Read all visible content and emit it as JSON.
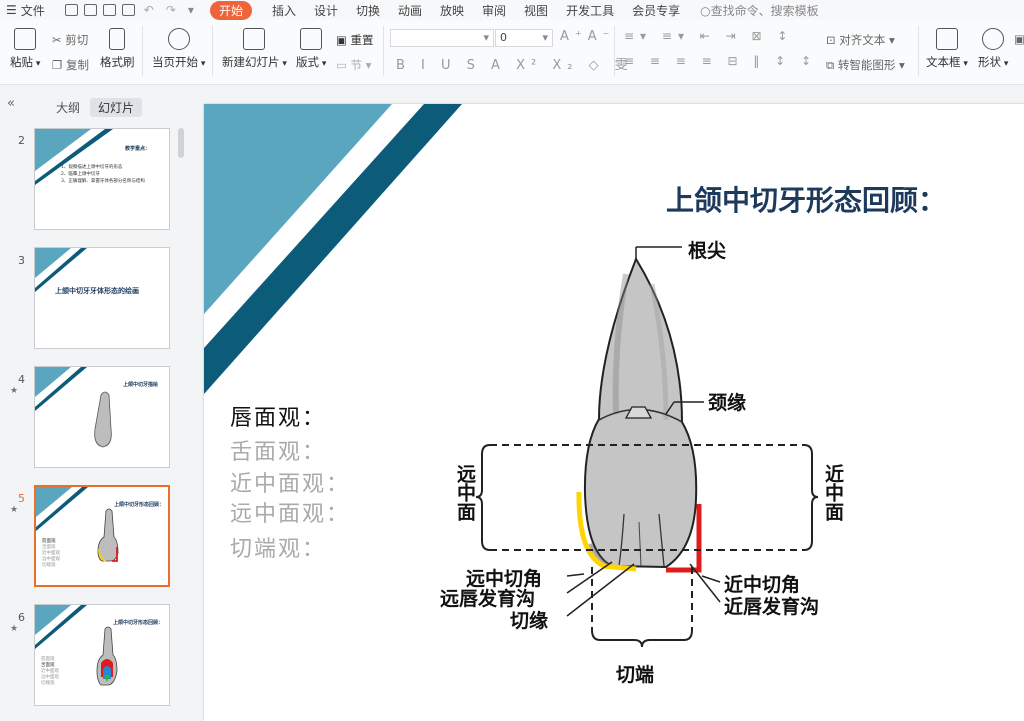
{
  "menubar": {
    "file_label": "文件",
    "tabs": [
      "开始",
      "插入",
      "设计",
      "切换",
      "动画",
      "放映",
      "审阅",
      "视图",
      "开发工具",
      "会员专享"
    ],
    "active_tab": "开始",
    "search_placeholder": "查找命令、搜索模板"
  },
  "ribbon": {
    "paste": "粘贴",
    "cut": "剪切",
    "copy": "复制",
    "format_painter": "格式刷",
    "from_current": "当页开始",
    "new_slide": "新建幻灯片",
    "layout": "版式",
    "reset": "重置",
    "section": "节",
    "font_size": "0",
    "align_text": "对齐文本",
    "smartart": "转智能图形",
    "textbox": "文本框",
    "shapes": "形状"
  },
  "panel": {
    "tab_outline": "大纲",
    "tab_slides": "幻灯片",
    "thumbnails": [
      {
        "num": "2",
        "title": "教学重点：",
        "lines": [
          "1、观察描述上颌中切牙的形态",
          "2、临摹上颌中切牙",
          "3、正确理解、掌握牙体各部分名称与结构"
        ]
      },
      {
        "num": "3",
        "title": "上颌中切牙牙体形态的绘画",
        "lines": []
      },
      {
        "num": "4",
        "title": "上颌中切牙描绘",
        "lines": []
      },
      {
        "num": "5",
        "title": "上颌中切牙形态回顾：",
        "lines": [
          "唇面观",
          "舌面观",
          "近中面观",
          "远中面观",
          "切端观"
        ]
      },
      {
        "num": "6",
        "title": "上颌中切牙形态回顾：",
        "lines": [
          "唇面观",
          "舌面观",
          "近中面观",
          "远中面观",
          "切端观"
        ]
      }
    ],
    "current_num": "5"
  },
  "slide": {
    "title": "上颌中切牙形态回顾：",
    "views": [
      "唇面观：",
      "舌面观：",
      "近中面观：",
      "远中面观：",
      "切端观："
    ],
    "active_view_index": 0,
    "labels": {
      "apex": "根尖",
      "cervical": "颈缘",
      "mesial_side": "近中面",
      "distal_side": "远中面",
      "distal_incisal_angle": "远中切角",
      "distal_labial_groove": "远唇发育沟",
      "incisal_edge": "切缘",
      "mesial_incisal_angle": "近中切角",
      "mesial_labial_groove": "近唇发育沟",
      "incisal_end": "切端"
    },
    "colors": {
      "accent_teal": "#5ba6bf",
      "accent_dark": "#0c5b78",
      "distal_highlight": "#ffd400",
      "mesial_highlight": "#e01b1b"
    }
  }
}
